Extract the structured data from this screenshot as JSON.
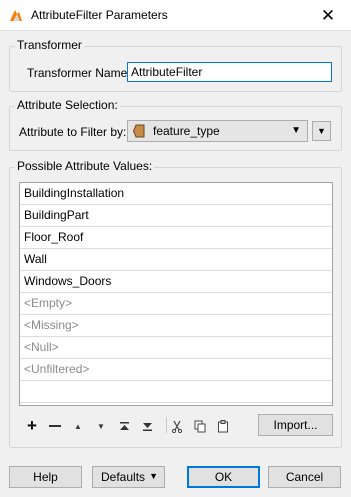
{
  "window": {
    "title": "AttributeFilter Parameters",
    "close_glyph": "✕"
  },
  "transformer": {
    "group_title": "Transformer",
    "name_label": "Transformer Name:",
    "name_value": "AttributeFilter"
  },
  "attribute_selection": {
    "group_title": "Attribute Selection:",
    "filter_label": "Attribute to Filter by:",
    "selected_value": "feature_type",
    "icon": "attribute-tag-icon"
  },
  "possible_values": {
    "group_title": "Possible Attribute Values:",
    "items": [
      {
        "label": "BuildingInstallation",
        "special": false
      },
      {
        "label": "BuildingPart",
        "special": false
      },
      {
        "label": "Floor_Roof",
        "special": false
      },
      {
        "label": "Wall",
        "special": false
      },
      {
        "label": "Windows_Doors",
        "special": false
      },
      {
        "label": "<Empty>",
        "special": true
      },
      {
        "label": "<Missing>",
        "special": true
      },
      {
        "label": "<Null>",
        "special": true
      },
      {
        "label": "<Unfiltered>",
        "special": true
      }
    ],
    "toolbar_icons": [
      "add-icon",
      "remove-icon",
      "move-up-icon",
      "move-down-icon",
      "move-to-top-icon",
      "move-to-bottom-icon",
      "cut-icon",
      "copy-icon",
      "paste-icon"
    ],
    "import_label": "Import..."
  },
  "footer": {
    "help_label": "Help",
    "defaults_label": "Defaults",
    "ok_label": "OK",
    "cancel_label": "Cancel"
  },
  "colors": {
    "accent": "#0078d7",
    "special_text": "#8a8a8a",
    "window_bg": "#f0f0f0"
  }
}
